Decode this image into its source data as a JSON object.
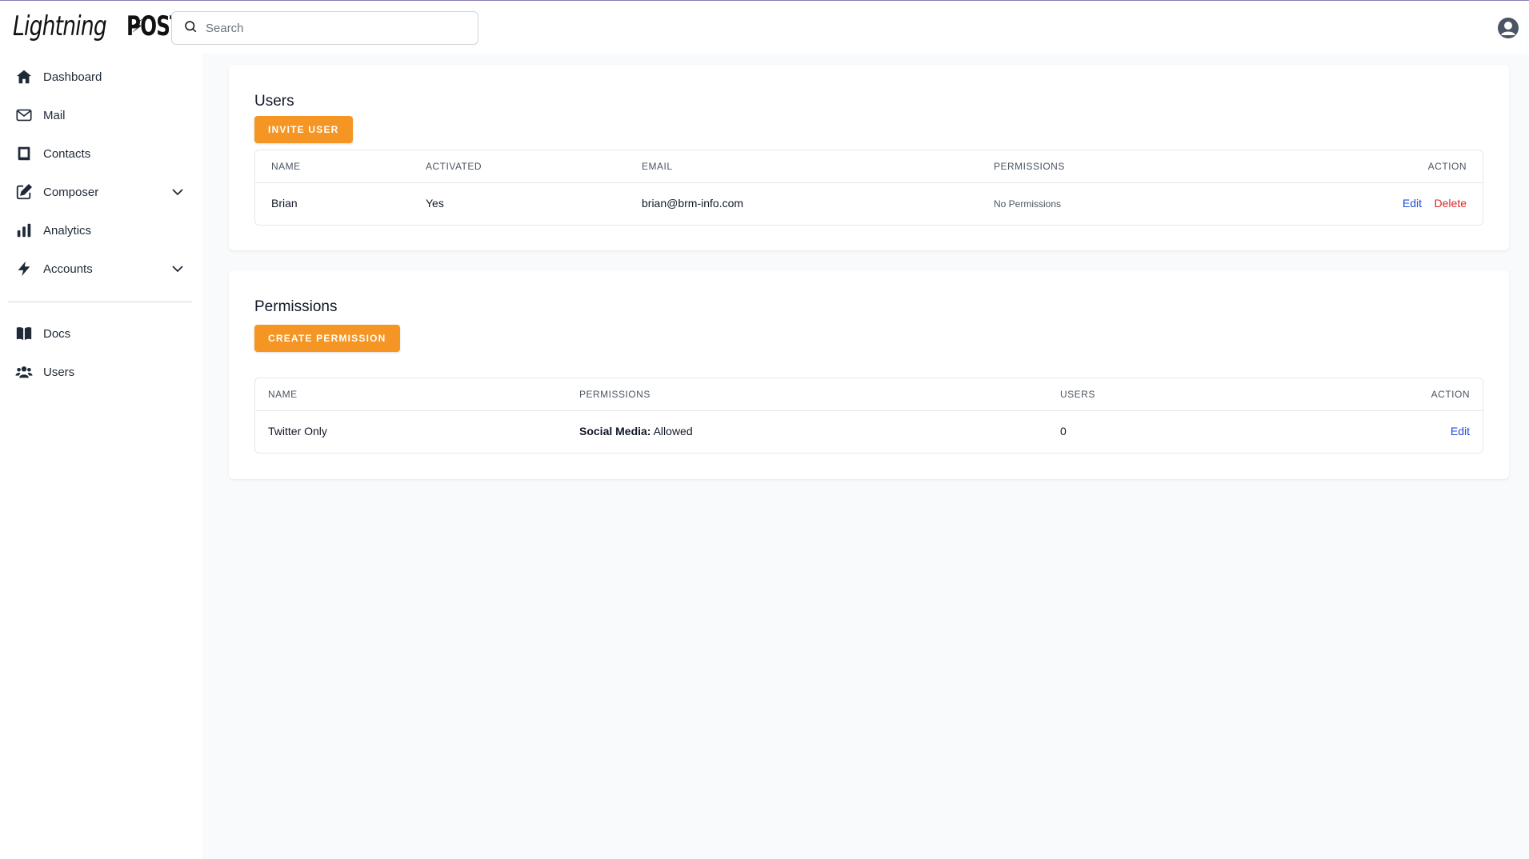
{
  "app": {
    "logo_text_light": "Lightning",
    "logo_text_bold": "POST"
  },
  "search": {
    "placeholder": "Search"
  },
  "sidebar": {
    "items": [
      {
        "label": "Dashboard",
        "icon": "home-icon"
      },
      {
        "label": "Mail",
        "icon": "mail-icon"
      },
      {
        "label": "Contacts",
        "icon": "contacts-icon"
      },
      {
        "label": "Composer",
        "icon": "edit-icon",
        "expandable": true
      },
      {
        "label": "Analytics",
        "icon": "bar-chart-icon"
      },
      {
        "label": "Accounts",
        "icon": "bolt-icon",
        "expandable": true
      }
    ],
    "secondary_items": [
      {
        "label": "Docs",
        "icon": "book-icon"
      },
      {
        "label": "Users",
        "icon": "users-icon"
      }
    ]
  },
  "users_section": {
    "title": "Users",
    "invite_button": "INVITE USER",
    "columns": [
      "NAME",
      "ACTIVATED",
      "EMAIL",
      "PERMISSIONS",
      "ACTION"
    ],
    "rows": [
      {
        "name": "Brian",
        "activated": "Yes",
        "email": "brian@brm-info.com",
        "permissions": "No Permissions",
        "edit": "Edit",
        "delete": "Delete"
      }
    ]
  },
  "permissions_section": {
    "title": "Permissions",
    "create_button": "CREATE PERMISSION",
    "columns": [
      "NAME",
      "PERMISSIONS",
      "USERS",
      "ACTION"
    ],
    "rows": [
      {
        "name": "Twitter Only",
        "permission_key": "Social Media:",
        "permission_value": "Allowed",
        "users": "0",
        "edit": "Edit"
      }
    ]
  },
  "colors": {
    "accent": "#f59524",
    "link": "#1d4ed8",
    "danger": "#dc2626"
  }
}
